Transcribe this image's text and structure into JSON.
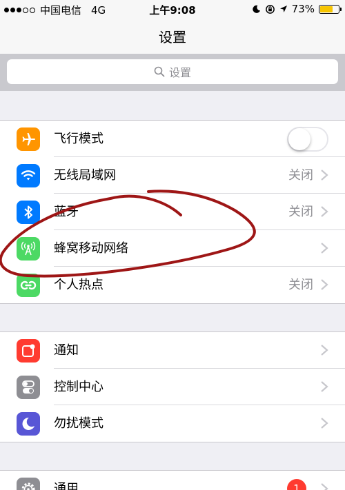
{
  "status_bar": {
    "carrier": "中国电信",
    "network": "4G",
    "time": "上午9:08",
    "battery_percent": "73%",
    "battery_level": 0.73,
    "battery_color": "#f7c500"
  },
  "nav": {
    "title": "设置"
  },
  "search": {
    "placeholder": "设置"
  },
  "groups": [
    {
      "rows": [
        {
          "label": "飞行模式",
          "icon": "airplane-icon",
          "icon_color": "#ff9500",
          "type": "toggle",
          "toggle_on": false
        },
        {
          "label": "无线局域网",
          "icon": "wifi-icon",
          "icon_color": "#007aff",
          "value": "关闭"
        },
        {
          "label": "蓝牙",
          "icon": "bluetooth-icon",
          "icon_color": "#007aff",
          "value": "关闭"
        },
        {
          "label": "蜂窝移动网络",
          "icon": "cellular-icon",
          "icon_color": "#4cd964",
          "value": ""
        },
        {
          "label": "个人热点",
          "icon": "hotspot-icon",
          "icon_color": "#4cd964",
          "value": "关闭"
        }
      ]
    },
    {
      "rows": [
        {
          "label": "通知",
          "icon": "notifications-icon",
          "icon_color": "#ff3b30"
        },
        {
          "label": "控制中心",
          "icon": "control-center-icon",
          "icon_color": "#8e8e93"
        },
        {
          "label": "勿扰模式",
          "icon": "do-not-disturb-icon",
          "icon_color": "#5856d6"
        }
      ]
    },
    {
      "rows": [
        {
          "label": "通用",
          "icon": "general-gear-icon",
          "icon_color": "#8e8e93",
          "badge": "1"
        }
      ]
    }
  ]
}
